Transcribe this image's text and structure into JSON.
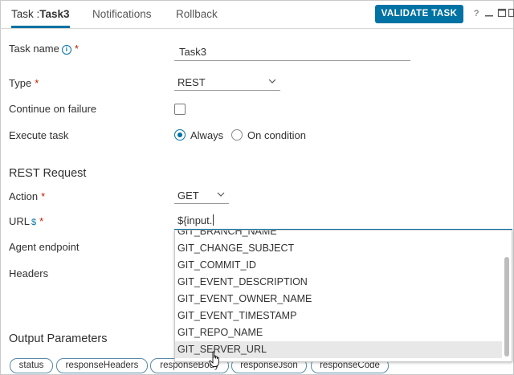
{
  "tabs": {
    "task_prefix": "Task :",
    "task_name": "Task3",
    "notifications": "Notifications",
    "rollback": "Rollback"
  },
  "header": {
    "validate_label": "VALIDATE TASK",
    "icons": [
      "help-icon",
      "minimize-icon",
      "maximize-icon",
      "dock-icon"
    ]
  },
  "form": {
    "task_name_label": "Task name",
    "task_name_value": "Task3",
    "type_label": "Type",
    "type_value": "REST",
    "continue_label": "Continue on failure",
    "continue_checked": false,
    "execute_label": "Execute task",
    "execute_options": [
      "Always",
      "On condition"
    ],
    "execute_selected": "Always",
    "required_marker": "*"
  },
  "rest": {
    "section_title": "REST Request",
    "action_label": "Action",
    "action_value": "GET",
    "url_label": "URL",
    "url_value": "${input.",
    "agent_label": "Agent endpoint",
    "headers_label": "Headers"
  },
  "dropdown": {
    "partial_item": "GIT_BRANCH_NAME",
    "items": [
      "GIT_CHANGE_SUBJECT",
      "GIT_COMMIT_ID",
      "GIT_EVENT_DESCRIPTION",
      "GIT_EVENT_OWNER_NAME",
      "GIT_EVENT_TIMESTAMP",
      "GIT_REPO_NAME",
      "GIT_SERVER_URL"
    ],
    "highlighted": "GIT_SERVER_URL"
  },
  "output": {
    "section_title": "Output Parameters",
    "params": [
      "status",
      "responseHeaders",
      "responseBody",
      "responseJson",
      "responseCode"
    ]
  },
  "colors": {
    "accent": "#0072a3",
    "required": "#c21d00",
    "highlight": "#e8e8e8"
  }
}
